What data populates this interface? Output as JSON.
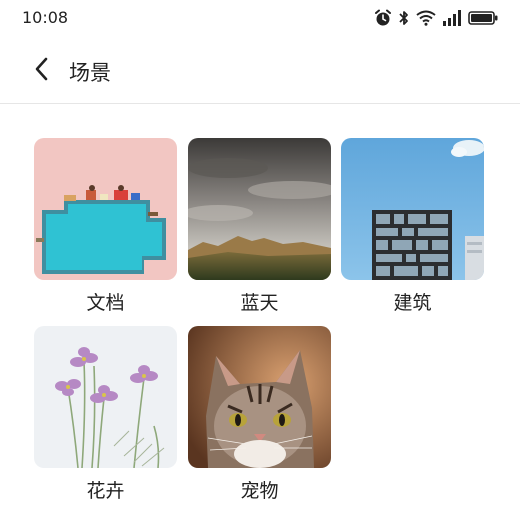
{
  "status_bar": {
    "time": "10:08",
    "icons": [
      "alarm-icon",
      "bluetooth-icon",
      "wifi-icon",
      "signal-icon",
      "battery-icon"
    ]
  },
  "header": {
    "back_icon": "chevron-left-icon",
    "title": "场景"
  },
  "scenes": [
    {
      "label": "文档",
      "image": "pool-photo"
    },
    {
      "label": "蓝天",
      "image": "sky-mountain-photo"
    },
    {
      "label": "建筑",
      "image": "building-photo"
    },
    {
      "label": "花卉",
      "image": "flower-photo"
    },
    {
      "label": "宠物",
      "image": "cat-photo"
    }
  ],
  "colors": {
    "divider": "#e6e6e6",
    "text": "#222222"
  }
}
